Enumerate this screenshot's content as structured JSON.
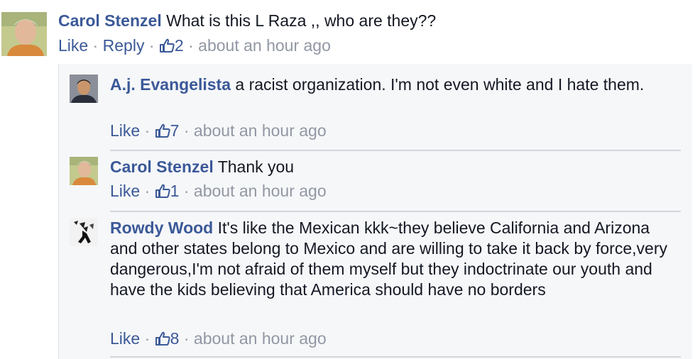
{
  "top_comment": {
    "author": "Carol Stenzel",
    "text": "What is this L Raza ,, who are they??",
    "like": "Like",
    "reply": "Reply",
    "likes": "2",
    "time": "about an hour ago"
  },
  "replies": [
    {
      "author": "A.j. Evangelista",
      "text": "a racist organization. I'm not even white and I hate them.",
      "like": "Like",
      "likes": "7",
      "time": "about an hour ago"
    },
    {
      "author": "Carol Stenzel",
      "text": "Thank you",
      "like": "Like",
      "likes": "1",
      "time": "about an hour ago"
    },
    {
      "author": "Rowdy Wood",
      "text": "It's like the Mexican kkk~they believe California and Arizona and other states belong to Mexico and are willing to take it back by force,very dangerous,I'm not afraid of them myself but they indoctrinate our youth and have the kids believing that America should have no borders",
      "like": "Like",
      "likes": "8",
      "time": "about an hour ago"
    }
  ],
  "separator": " · ",
  "colors": {
    "link": "#3b5998",
    "meta": "#9197a3",
    "reply_bg": "#f6f7f9",
    "divider": "#d3d6db"
  },
  "icons": {
    "like_count": "thumbs-up-icon"
  }
}
